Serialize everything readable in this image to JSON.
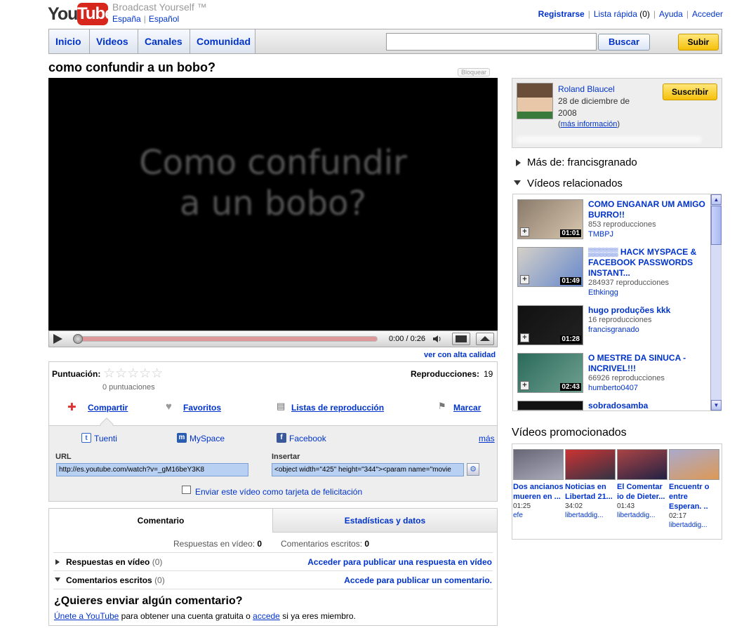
{
  "header": {
    "logo_you": "You",
    "logo_tube": "Tube",
    "tagline": "Broadcast Yourself ™",
    "region": "España",
    "language": "Español",
    "links": {
      "register": "Registrarse",
      "quicklist": "Lista rápida",
      "quicklist_count": "(0)",
      "help": "Ayuda",
      "signin": "Acceder"
    }
  },
  "nav": {
    "tabs": [
      "Inicio",
      "Videos",
      "Canales",
      "Comunidad"
    ],
    "search_button": "Buscar",
    "upload_button": "Subir"
  },
  "video": {
    "title": "como confundir a un bobo?",
    "block_label": "Bloquear",
    "overlay_line1": "Como confundir",
    "overlay_line2": "a un bobo?",
    "time": "0:00 / 0:26",
    "hq_link": "ver con alta calidad"
  },
  "info": {
    "rating_label": "Puntuación:",
    "stars": "☆☆☆☆☆",
    "rating_count": "0 puntuaciones",
    "views_label": "Reproducciones:",
    "views": "19",
    "actions": {
      "share": "Compartir",
      "favorites": "Favoritos",
      "playlists": "Listas de reproducción",
      "flag": "Marcar"
    },
    "social": {
      "tuenti": "Tuenti",
      "myspace": "MySpace",
      "facebook": "Facebook",
      "more": "más"
    },
    "url_label": "URL",
    "url_value": "http://es.youtube.com/watch?v=_gM16beY3K8",
    "embed_label": "Insertar",
    "embed_value": "<object width=\"425\" height=\"344\"><param name=\"movie",
    "ecard": "Enviar este vídeo como tarjeta de felicitación"
  },
  "comments": {
    "tab_comment": "Comentario",
    "tab_stats": "Estadísticas y datos",
    "video_responses_label": "Respuestas en vídeo:",
    "video_responses_count": "0",
    "written_comments_label": "Comentarios escritos:",
    "written_comments_count": "0",
    "rows": [
      {
        "title": "Respuestas en vídeo",
        "count": "(0)",
        "link": "Acceder para publicar una respuesta en vídeo"
      },
      {
        "title": "Comentarios escritos",
        "count": "(0)",
        "link": "Accede para publicar un comentario."
      }
    ],
    "prompt": "¿Quieres enviar algún comentario?",
    "join_link": "Únete a YouTube",
    "join_middle": "para obtener una cuenta gratuita o",
    "signin_link": "accede",
    "join_end": "si ya eres miembro."
  },
  "uploader": {
    "name": "Roland Blaucel",
    "date": "28 de diciembre de 2008",
    "more_info_open": "(",
    "more_info": "más información",
    "more_info_close": ")",
    "subscribe": "Suscribir"
  },
  "more_from": "Más de: francisgranado",
  "related_title": "Vídeos relacionados",
  "related": [
    {
      "title": "COMO ENGANAR UM AMIGO BURRO!!",
      "views": "853 reproducciones",
      "user": "TMBPJ",
      "duration": "01:01",
      "thumb_colors": [
        "#8a7a6a",
        "#d8c8b0"
      ]
    },
    {
      "title": "▒▒▒▒▒ HACK MYSPACE & FACEBOOK PASSWORDS INSTANT...",
      "views": "284937 reproducciones",
      "user": "Ethkingg",
      "duration": "01:49",
      "thumb_colors": [
        "#d4d0c8",
        "#6688cc"
      ]
    },
    {
      "title": "hugo produções kkk",
      "views": "16 reproducciones",
      "user": "francisgranado",
      "duration": "01:28",
      "thumb_colors": [
        "#111111",
        "#222222"
      ]
    },
    {
      "title": "O MESTRE DA SINUCA - INCRIVEL!!!",
      "views": "66926 reproducciones",
      "user": "humberto0407",
      "duration": "02:43",
      "thumb_colors": [
        "#2a6a5a",
        "#6fa090"
      ]
    },
    {
      "title": "sobradosamba",
      "views": "",
      "user": "",
      "duration": "",
      "thumb_colors": [
        "#111111",
        "#111111"
      ]
    }
  ],
  "promo_title": "Vídeos promocionados",
  "promoted": [
    {
      "title": "Dos ancianos mueren en ...",
      "duration": "01:25",
      "user": "efe",
      "thumb_colors": [
        "#667",
        "#aab"
      ]
    },
    {
      "title": "Noticias en Libertad 21...",
      "duration": "34:02",
      "user": "libertaddig...",
      "thumb_colors": [
        "#c33",
        "#334"
      ]
    },
    {
      "title": "El Comentar io de Dieter...",
      "duration": "01:43",
      "user": "libertaddig...",
      "thumb_colors": [
        "#a44",
        "#224"
      ]
    },
    {
      "title": "Encuentr o entre Esperan. ..",
      "duration": "02:17",
      "user": "libertaddig...",
      "thumb_colors": [
        "#aac",
        "#d95"
      ]
    }
  ],
  "colors": {
    "link": "#0033cc",
    "accent_red": "#d7261c",
    "subscribe_yellow": "#f5c00a"
  }
}
